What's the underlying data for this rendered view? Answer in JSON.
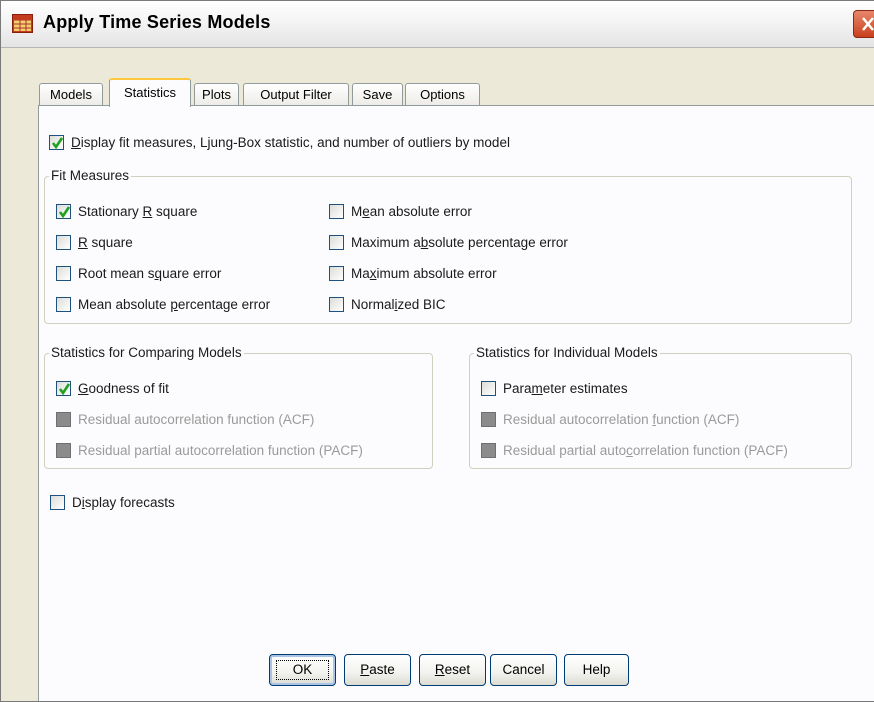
{
  "window": {
    "title": "Apply Time Series Models"
  },
  "tabs": [
    {
      "label": "Models",
      "active": false
    },
    {
      "label": "Statistics",
      "active": true
    },
    {
      "label": "Plots",
      "active": false
    },
    {
      "label": "Output Filter",
      "active": false
    },
    {
      "label": "Save",
      "active": false
    },
    {
      "label": "Options",
      "active": false
    }
  ],
  "display_fit": {
    "label_pre": "",
    "label_ul": "D",
    "label_post": "isplay fit measures, Ljung-Box statistic, and number of outliers by model",
    "checked": true
  },
  "fit_measures": {
    "legend": "Fit Measures",
    "items": [
      {
        "pre": "Stationary ",
        "ul": "R",
        "post": " square",
        "checked": true,
        "enabled": true
      },
      {
        "pre": "",
        "ul": "R",
        "post": " square",
        "checked": false,
        "enabled": true
      },
      {
        "pre": "Root mean s",
        "ul": "q",
        "post": "uare error",
        "checked": false,
        "enabled": true
      },
      {
        "pre": "Mean absolute ",
        "ul": "p",
        "post": "ercentage error",
        "checked": false,
        "enabled": true
      },
      {
        "pre": "M",
        "ul": "e",
        "post": "an absolute error",
        "checked": false,
        "enabled": true
      },
      {
        "pre": "Maximum a",
        "ul": "b",
        "post": "solute percentage error",
        "checked": false,
        "enabled": true
      },
      {
        "pre": "Ma",
        "ul": "x",
        "post": "imum absolute error",
        "checked": false,
        "enabled": true
      },
      {
        "pre": "Normal",
        "ul": "i",
        "post": "zed BIC",
        "checked": false,
        "enabled": true
      }
    ]
  },
  "comparing": {
    "legend": "Statistics for Comparing Models",
    "items": [
      {
        "pre": "",
        "ul": "G",
        "post": "oodness of fit",
        "checked": true,
        "enabled": true
      },
      {
        "pre": "Residual autocorrelation function (ACF)",
        "ul": "",
        "post": "",
        "checked": false,
        "enabled": false
      },
      {
        "pre": "Residual partial autocorrelation function (PACF)",
        "ul": "",
        "post": "",
        "checked": false,
        "enabled": false
      }
    ]
  },
  "individual": {
    "legend": "Statistics for Individual Models",
    "items": [
      {
        "pre": "Para",
        "ul": "m",
        "post": "eter estimates",
        "checked": false,
        "enabled": true
      },
      {
        "pre": "Residual autocorrelation ",
        "ul": "f",
        "post": "unction (ACF)",
        "checked": false,
        "enabled": false
      },
      {
        "pre": "Residual partial auto",
        "ul": "c",
        "post": "orrelation function (PACF)",
        "checked": false,
        "enabled": false
      }
    ]
  },
  "display_forecasts": {
    "pre": "D",
    "ul": "i",
    "post": "splay forecasts",
    "checked": false
  },
  "buttons": {
    "ok": "OK",
    "paste_ul": "P",
    "paste_post": "aste",
    "reset_ul": "R",
    "reset_post": "eset",
    "cancel": "Cancel",
    "help": "Help"
  },
  "icons": {
    "app": "table-icon",
    "close": "close-icon",
    "check": "checkmark-icon"
  },
  "colors": {
    "dialog_bg": "#ece9d8",
    "panel_bg": "#fcfcfe",
    "active_tab_accent": "#ffc83c",
    "checkbox_border": "#1c5180",
    "close_button": "#c9401d"
  }
}
